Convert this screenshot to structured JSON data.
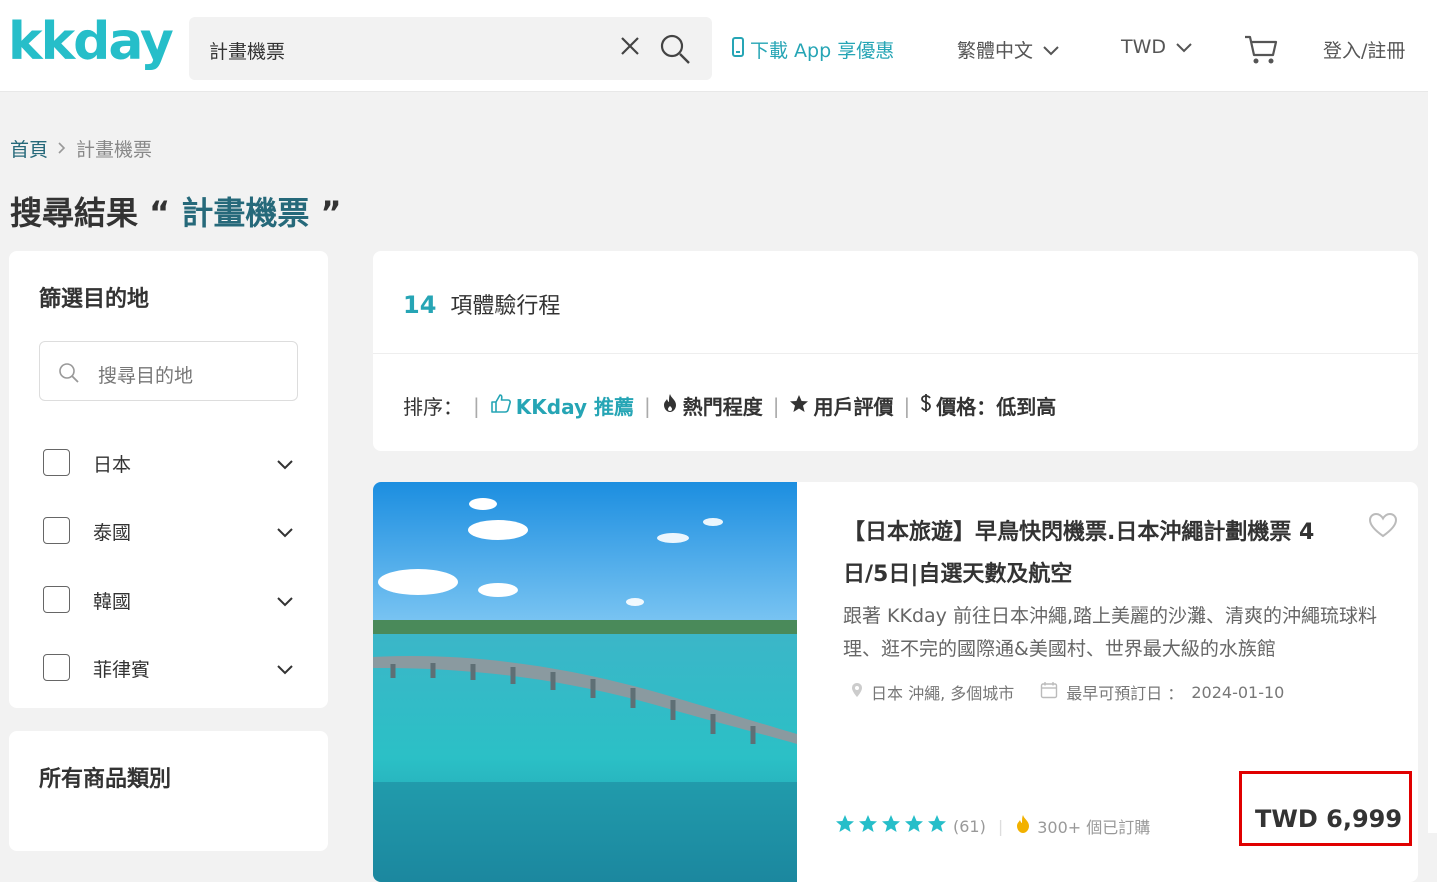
{
  "header": {
    "logo": "kkday",
    "search_value": "計畫機票",
    "app_promo": "下載 App 享優惠",
    "language": "繁體中文",
    "currency": "TWD",
    "login": "登入/註冊"
  },
  "breadcrumb": {
    "home": "首頁",
    "current": "計畫機票"
  },
  "results": {
    "prefix": "搜尋結果",
    "open_quote": "“",
    "keyword": "計畫機票",
    "close_quote": "”"
  },
  "filter": {
    "title": "篩選目的地",
    "search_placeholder": "搜尋目的地",
    "destinations": [
      "日本",
      "泰國",
      "韓國",
      "菲律賓"
    ]
  },
  "categories": {
    "title": "所有商品類別"
  },
  "summary": {
    "count": "14",
    "count_label": "項體驗行程"
  },
  "sort": {
    "label": "排序：",
    "options": [
      "KKday 推薦",
      "熱門程度",
      "用戶評價",
      "價格：低到高"
    ]
  },
  "product": {
    "title": "【日本旅遊】早鳥快閃機票.日本沖繩計劃機票 4日/5日|自選天數及航空",
    "description": "跟著 KKday 前往日本沖繩,踏上美麗的沙灘、清爽的沖繩琉球料理、逛不完的國際通&美國村、世界最大級的水族館",
    "location": "日本 沖繩, 多個城市",
    "earliest_label": "最早可預訂日 ：",
    "earliest_date": "2024-01-10",
    "rating_count": "(61)",
    "booked": "300+ 個已訂購",
    "price": "TWD 6,999",
    "rating": 5
  },
  "colors": {
    "brand": "#26bec9",
    "accent_dark": "#26697a",
    "highlight": "#e00000"
  }
}
